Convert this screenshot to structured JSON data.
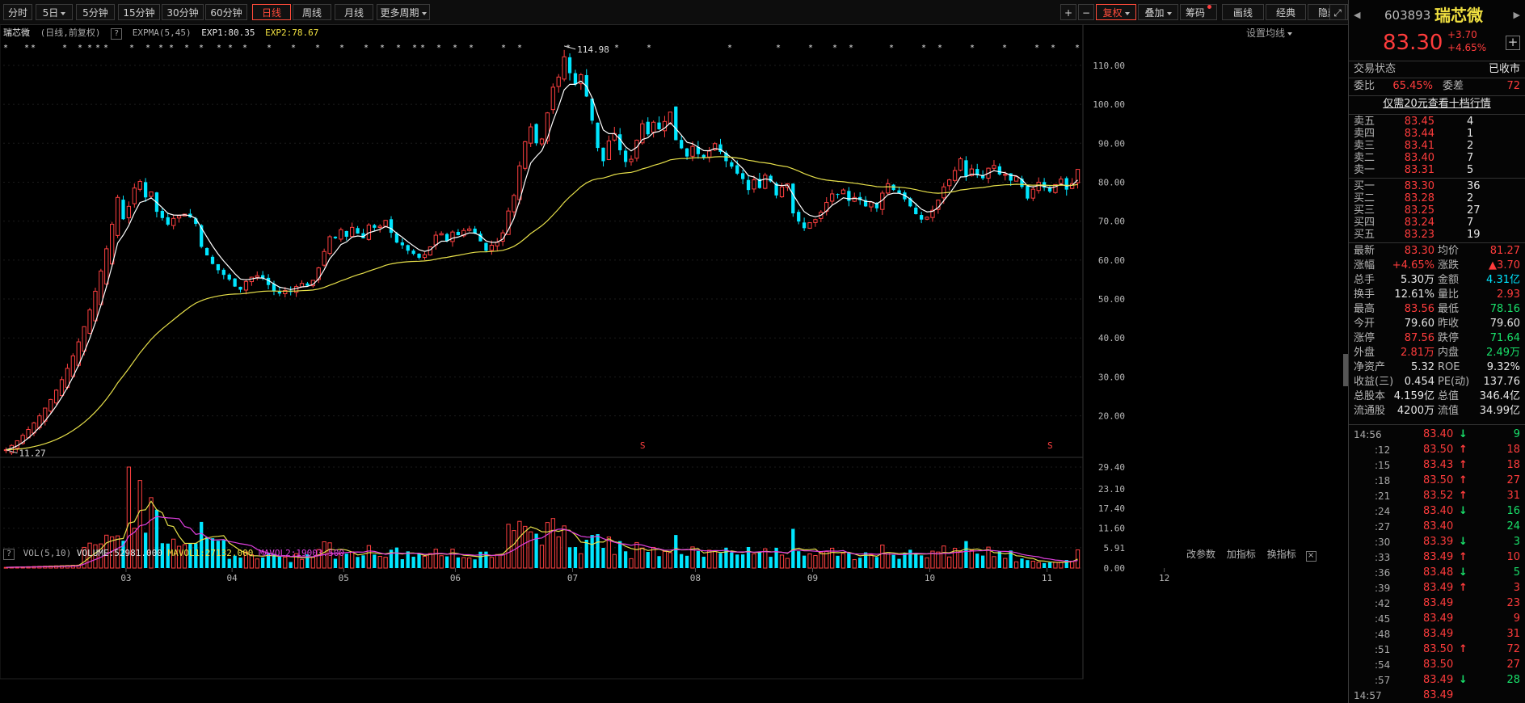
{
  "toolbar": {
    "tabs": [
      "分时",
      "5日",
      "5分钟",
      "15分钟",
      "30分钟",
      "60分钟",
      "日线",
      "周线",
      "月线",
      "更多周期"
    ],
    "active_tab": "日线",
    "right_buttons": [
      "+",
      "−",
      "复权",
      "叠加",
      "筹码",
      "画线",
      "经典",
      "隐藏"
    ],
    "accent": "#ff4b3a"
  },
  "chart_header": {
    "name": "瑞芯微",
    "mode": "(日线,前复权)",
    "indicator": "EXPMA(5,45)",
    "exp1": "EXP1:80.35",
    "exp2": "EXP2:78.67",
    "set_ma": "设置均线"
  },
  "volume_header": {
    "indicator": "VOL(5,10)",
    "volume": "VOLUME:52981.000",
    "mavol1": "MAVOL1:27132.000",
    "mavol2": "MAVOL2:19003.500",
    "tools": [
      "改参数",
      "加指标",
      "换指标"
    ]
  },
  "annotations": {
    "high_label": "114.98",
    "low_label": "11.27",
    "s_marker": "S"
  },
  "chart_data": [
    {
      "type": "candlestick",
      "title": "瑞芯微 (日线,前复权)",
      "y_ticks": [
        "110.00",
        "100.00",
        "90.00",
        "80.00",
        "70.00",
        "60.00",
        "50.00",
        "40.00",
        "30.00",
        "20.00"
      ],
      "ylim": [
        11,
        116
      ],
      "x_month_ticks": [
        "03",
        "04",
        "05",
        "06",
        "07",
        "08",
        "09",
        "10",
        "11",
        "12"
      ],
      "close": [
        11.3,
        12.4,
        13.6,
        15.0,
        16.5,
        18.2,
        20.0,
        22.0,
        24.2,
        26.6,
        29.3,
        32.2,
        35.4,
        39.0,
        42.9,
        47.2,
        52.0,
        57.2,
        62.9,
        69.2,
        76.1,
        70.5,
        73.8,
        78.5,
        80.2,
        76.1,
        77.5,
        72.4,
        70.8,
        69.1,
        70.7,
        71.4,
        71.8,
        71.0,
        69.3,
        63.4,
        61.2,
        59.0,
        57.4,
        56.2,
        55.0,
        53.2,
        52.4,
        54.5,
        55.6,
        56.0,
        55.3,
        53.6,
        52.0,
        51.4,
        52.2,
        51.8,
        53.2,
        54.0,
        53.4,
        54.8,
        58.0,
        62.2,
        66.0,
        65.6,
        67.8,
        66.0,
        68.4,
        66.8,
        65.6,
        69.0,
        68.3,
        68.7,
        70.2,
        67.0,
        64.5,
        63.8,
        62.4,
        61.6,
        60.6,
        61.4,
        63.4,
        66.4,
        66.8,
        64.9,
        67.2,
        66.4,
        67.6,
        68.0,
        66.8,
        64.8,
        62.4,
        63.8,
        64.6,
        67.0,
        72.6,
        76.6,
        84.2,
        90.4,
        94.2,
        90.0,
        91.1,
        97.8,
        104.4,
        107.0,
        112.2,
        108.0,
        105.1,
        107.6,
        102.0,
        95.8,
        88.8,
        85.4,
        90.6,
        92.5,
        88.2,
        85.2,
        85.9,
        90.8,
        95.0,
        92.3,
        95.4,
        93.6,
        95.6,
        98.0,
        90.8,
        88.7,
        86.6,
        89.2,
        87.2,
        86.3,
        88.0,
        89.9,
        87.8,
        85.4,
        84.0,
        82.2,
        80.8,
        78.0,
        80.6,
        78.5,
        81.8,
        80.2,
        76.6,
        78.8,
        79.6,
        72.0,
        69.9,
        68.2,
        69.6,
        70.4,
        72.3,
        74.8,
        77.0,
        76.8,
        78.0,
        75.2,
        76.1,
        75.4,
        73.8,
        74.9,
        73.3,
        77.2,
        79.6,
        78.0,
        77.1,
        75.6,
        73.8,
        71.8,
        70.4,
        71.0,
        72.8,
        75.4,
        78.8,
        80.6,
        83.0,
        86.0,
        81.5,
        83.4,
        81.8,
        81.0,
        83.6,
        84.3,
        82.0,
        82.0,
        80.4,
        81.4,
        78.8,
        75.8,
        78.2,
        80.0,
        78.6,
        77.6,
        79.4,
        80.8,
        78.1,
        79.6,
        83.3
      ],
      "series": [
        {
          "name": "EXP1",
          "span": 5
        },
        {
          "name": "EXP2",
          "span": 45
        }
      ]
    },
    {
      "type": "bar",
      "title": "VOL(5,10)",
      "y_ticks": [
        "29.40",
        "23.10",
        "17.40",
        "11.60",
        "5.91",
        "0.00"
      ],
      "ylim": [
        0,
        29.4
      ],
      "series": [
        {
          "name": "MAVOL1",
          "span": 5
        },
        {
          "name": "MAVOL2",
          "span": 10
        }
      ]
    }
  ],
  "quote": {
    "code": "603893",
    "name": "瑞芯微",
    "price": "83.30",
    "change": "+3.70",
    "change_pct": "+4.65%",
    "status_label": "交易状态",
    "status_value": "已收市",
    "wb_label": "委比",
    "wb_value": "65.45%",
    "wc_label": "委差",
    "wc_value": "72",
    "promo": "仅需20元查看十档行情",
    "asks": [
      {
        "label": "卖五",
        "price": "83.45",
        "vol": "4"
      },
      {
        "label": "卖四",
        "price": "83.44",
        "vol": "1"
      },
      {
        "label": "卖三",
        "price": "83.41",
        "vol": "2"
      },
      {
        "label": "卖二",
        "price": "83.40",
        "vol": "7"
      },
      {
        "label": "卖一",
        "price": "83.31",
        "vol": "5"
      }
    ],
    "bids": [
      {
        "label": "买一",
        "price": "83.30",
        "vol": "36"
      },
      {
        "label": "买二",
        "price": "83.28",
        "vol": "2"
      },
      {
        "label": "买三",
        "price": "83.25",
        "vol": "27"
      },
      {
        "label": "买四",
        "price": "83.24",
        "vol": "7"
      },
      {
        "label": "买五",
        "price": "83.23",
        "vol": "19"
      }
    ],
    "stats": [
      {
        "l1": "最新",
        "v1": "83.30",
        "c1": "red",
        "l2": "均价",
        "v2": "81.27",
        "c2": "red"
      },
      {
        "l1": "涨幅",
        "v1": "+4.65%",
        "c1": "red",
        "l2": "涨跌",
        "v2": "▲3.70",
        "c2": "red"
      },
      {
        "l1": "总手",
        "v1": "5.30万",
        "c1": "white",
        "l2": "金额",
        "v2": "4.31亿",
        "c2": "cyan"
      },
      {
        "l1": "换手",
        "v1": "12.61%",
        "c1": "white",
        "l2": "量比",
        "v2": "2.93",
        "c2": "red"
      },
      {
        "l1": "最高",
        "v1": "83.56",
        "c1": "red",
        "l2": "最低",
        "v2": "78.16",
        "c2": "green"
      },
      {
        "l1": "今开",
        "v1": "79.60",
        "c1": "white",
        "l2": "昨收",
        "v2": "79.60",
        "c2": "white"
      },
      {
        "l1": "涨停",
        "v1": "87.56",
        "c1": "red",
        "l2": "跌停",
        "v2": "71.64",
        "c2": "green"
      },
      {
        "l1": "外盘",
        "v1": "2.81万",
        "c1": "red",
        "l2": "内盘",
        "v2": "2.49万",
        "c2": "green"
      },
      {
        "l1": "净资产",
        "v1": "5.32",
        "c1": "white",
        "l2": "ROE",
        "v2": "9.32%",
        "c2": "white"
      },
      {
        "l1": "收益(三)",
        "v1": "0.454",
        "c1": "white",
        "l2": "PE(动)",
        "v2": "137.76",
        "c2": "white"
      },
      {
        "l1": "总股本",
        "v1": "4.159亿",
        "c1": "white",
        "l2": "总值",
        "v2": "346.4亿",
        "c2": "white"
      },
      {
        "l1": "流通股",
        "v1": "4200万",
        "c1": "white",
        "l2": "流值",
        "v2": "34.99亿",
        "c2": "white"
      }
    ],
    "ticks": [
      {
        "t": "14:56",
        "p": "83.40",
        "a": "down",
        "v": "9",
        "vc": "green"
      },
      {
        "t": ":12",
        "p": "83.50",
        "a": "up",
        "v": "18",
        "vc": "red"
      },
      {
        "t": ":15",
        "p": "83.43",
        "a": "up",
        "v": "18",
        "vc": "red"
      },
      {
        "t": ":18",
        "p": "83.50",
        "a": "up",
        "v": "27",
        "vc": "red"
      },
      {
        "t": ":21",
        "p": "83.52",
        "a": "up",
        "v": "31",
        "vc": "red"
      },
      {
        "t": ":24",
        "p": "83.40",
        "a": "down",
        "v": "16",
        "vc": "green"
      },
      {
        "t": ":27",
        "p": "83.40",
        "a": "",
        "v": "24",
        "vc": "green"
      },
      {
        "t": ":30",
        "p": "83.39",
        "a": "down",
        "v": "3",
        "vc": "green"
      },
      {
        "t": ":33",
        "p": "83.49",
        "a": "up",
        "v": "10",
        "vc": "red"
      },
      {
        "t": ":36",
        "p": "83.48",
        "a": "down",
        "v": "5",
        "vc": "green"
      },
      {
        "t": ":39",
        "p": "83.49",
        "a": "up",
        "v": "3",
        "vc": "red"
      },
      {
        "t": ":42",
        "p": "83.49",
        "a": "",
        "v": "23",
        "vc": "red"
      },
      {
        "t": ":45",
        "p": "83.49",
        "a": "",
        "v": "9",
        "vc": "red"
      },
      {
        "t": ":48",
        "p": "83.49",
        "a": "",
        "v": "31",
        "vc": "red"
      },
      {
        "t": ":51",
        "p": "83.50",
        "a": "up",
        "v": "72",
        "vc": "red"
      },
      {
        "t": ":54",
        "p": "83.50",
        "a": "",
        "v": "27",
        "vc": "red"
      },
      {
        "t": ":57",
        "p": "83.49",
        "a": "down",
        "v": "28",
        "vc": "green"
      },
      {
        "t": "14:57",
        "p": "83.49",
        "a": "",
        "v": "",
        "vc": "red"
      }
    ]
  },
  "colors": {
    "up": "#ff4040",
    "down": "#00e6ff",
    "exp1": "#ffffff",
    "exp2": "#e7e04a",
    "mavol2": "#e040e0",
    "grid": "#1c1c1c"
  }
}
